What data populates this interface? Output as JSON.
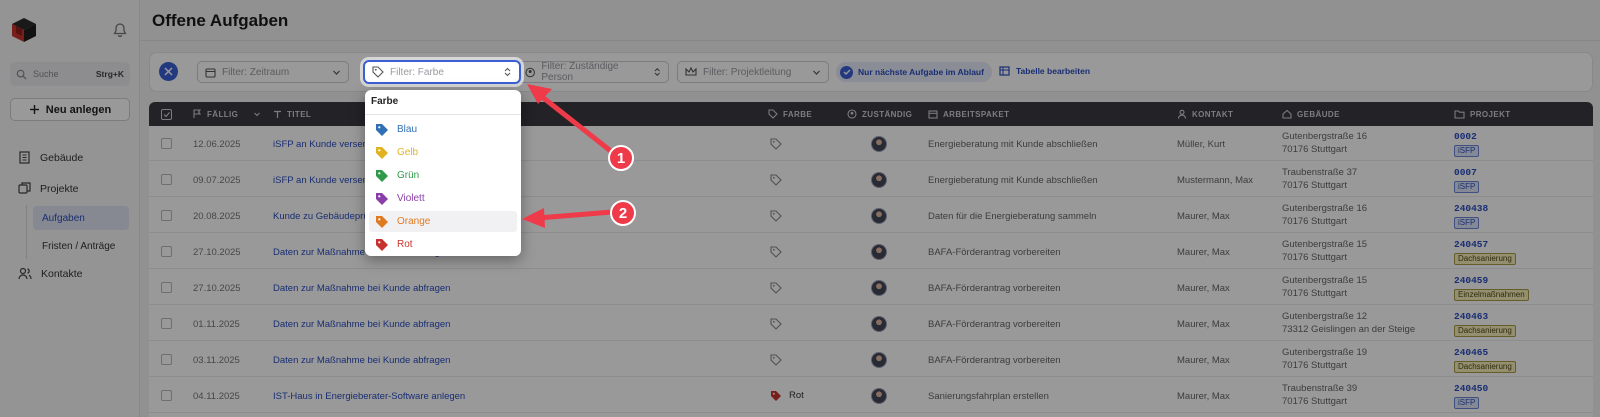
{
  "sidebar": {
    "search_placeholder": "Suche",
    "search_shortcut": "Strg+K",
    "new_button": "Neu anlegen",
    "items": [
      {
        "label": "Gebäude",
        "icon": "building-icon"
      },
      {
        "label": "Projekte",
        "icon": "projects-icon"
      },
      {
        "label": "Aufgaben",
        "sub": true,
        "active": true
      },
      {
        "label": "Fristen / Anträge",
        "sub": true
      },
      {
        "label": "Kontakte",
        "icon": "contacts-icon"
      }
    ]
  },
  "header": {
    "title": "Offene Aufgaben"
  },
  "filters": {
    "zeitraum": "Filter: Zeitraum",
    "farbe": "Filter: Farbe",
    "person": "Filter: Zuständige Person",
    "projektleitung": "Filter: Projektleitung",
    "toggle_label": "Nur nächste Aufgabe im Ablauf",
    "edit_table": "Tabelle bearbeiten"
  },
  "table": {
    "columns": [
      "FÄLLIG",
      "TITEL",
      "FARBE",
      "ZUSTÄNDIG",
      "ARBEITSPAKET",
      "KONTAKT",
      "GEBÄUDE",
      "PROJEKT"
    ],
    "rows": [
      {
        "due": "12.06.2025",
        "title": "iSFP an Kunde versenden",
        "farbe": "",
        "arbeitspaket": "Energieberatung mit Kunde abschließen",
        "kontakt": "Müller, Kurt",
        "geb1": "Gutenbergstraße 16",
        "geb2": "70176 Stuttgart",
        "projekt": "0002",
        "badge": "iSFP",
        "badge_color": "blue"
      },
      {
        "due": "09.07.2025",
        "title": "iSFP an Kunde versenden",
        "farbe": "",
        "arbeitspaket": "Energieberatung mit Kunde abschließen",
        "kontakt": "Mustermann, Max",
        "geb1": "Traubenstraße 37",
        "geb2": "70176 Stuttgart",
        "projekt": "0007",
        "badge": "iSFP",
        "badge_color": "blue"
      },
      {
        "due": "20.08.2025",
        "title": "Kunde zu Gebäudeprüfung",
        "farbe": "",
        "arbeitspaket": "Daten für die Energieberatung sammeln",
        "kontakt": "Maurer, Max",
        "geb1": "Gutenbergstraße 16",
        "geb2": "70176 Stuttgart",
        "projekt": "240438",
        "badge": "iSFP",
        "badge_color": "blue"
      },
      {
        "due": "27.10.2025",
        "title": "Daten zur Maßnahme bei Kunde abfragen",
        "farbe": "",
        "arbeitspaket": "BAFA-Förderantrag vorbereiten",
        "kontakt": "Maurer, Max",
        "geb1": "Gutenbergstraße 15",
        "geb2": "70176 Stuttgart",
        "projekt": "240457",
        "badge": "Dachsanierung",
        "badge_color": "yellow"
      },
      {
        "due": "27.10.2025",
        "title": "Daten zur Maßnahme bei Kunde abfragen",
        "farbe": "",
        "arbeitspaket": "BAFA-Förderantrag vorbereiten",
        "kontakt": "Maurer, Max",
        "geb1": "Gutenbergstraße 15",
        "geb2": "70176 Stuttgart",
        "projekt": "240459",
        "badge": "Einzelmaßnahmen",
        "badge_color": "yellow"
      },
      {
        "due": "01.11.2025",
        "title": "Daten zur Maßnahme bei Kunde abfragen",
        "farbe": "",
        "arbeitspaket": "BAFA-Förderantrag vorbereiten",
        "kontakt": "Maurer, Max",
        "geb1": "Gutenbergstraße 12",
        "geb2": "73312 Geislingen an der Steige",
        "projekt": "240463",
        "badge": "Dachsanierung",
        "badge_color": "yellow"
      },
      {
        "due": "03.11.2025",
        "title": "Daten zur Maßnahme bei Kunde abfragen",
        "farbe": "",
        "arbeitspaket": "BAFA-Förderantrag vorbereiten",
        "kontakt": "Maurer, Max",
        "geb1": "Gutenbergstraße 19",
        "geb2": "70176 Stuttgart",
        "projekt": "240465",
        "badge": "Dachsanierung",
        "badge_color": "yellow"
      },
      {
        "due": "04.11.2025",
        "title": "IST-Haus in Energieberater-Software anlegen",
        "farbe": "Rot",
        "arbeitspaket": "Sanierungsfahrplan erstellen",
        "kontakt": "Maurer, Max",
        "geb1": "Traubenstraße 39",
        "geb2": "70176 Stuttgart",
        "projekt": "240450",
        "badge": "iSFP",
        "badge_color": "blue"
      }
    ]
  },
  "dropdown": {
    "header": "Farbe",
    "options": [
      {
        "label": "Blau",
        "color": "#2f6fb6"
      },
      {
        "label": "Gelb",
        "color": "#e2b321"
      },
      {
        "label": "Grün",
        "color": "#2f9a4a"
      },
      {
        "label": "Violett",
        "color": "#8a3fa8"
      },
      {
        "label": "Orange",
        "color": "#e07a22"
      },
      {
        "label": "Rot",
        "color": "#c8322e"
      }
    ]
  },
  "annotations": [
    "1",
    "2"
  ],
  "colors": {
    "accent": "#3b5fd4",
    "marker": "#ef3a4a",
    "header": "#3a3a42"
  }
}
